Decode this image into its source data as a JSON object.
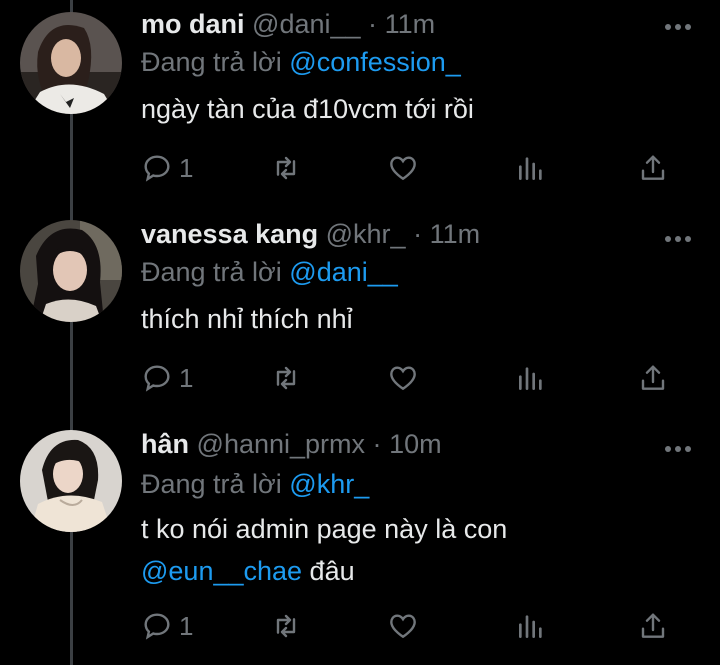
{
  "tweets": [
    {
      "name": "mo dani",
      "handle": "@dani__",
      "time": "11m",
      "reply_prefix": "Đang trả lời",
      "reply_to": "@confession_",
      "text": "ngày tàn của đ10vcm tới rồi",
      "mention_in_text": "",
      "text_after": "",
      "reply_count": "1"
    },
    {
      "name": "vanessa kang",
      "handle": "@khr_",
      "time": "11m",
      "reply_prefix": "Đang trả lời",
      "reply_to": "@dani__",
      "text": "thích nhỉ thích nhỉ",
      "mention_in_text": "",
      "text_after": "",
      "reply_count": "1"
    },
    {
      "name": "hân",
      "handle": "@hanni_prmx",
      "time": "10m",
      "reply_prefix": "Đang trả lời",
      "reply_to": "@khr_",
      "text": "t ko nói admin page này là con",
      "mention_in_text": "@eun__chae",
      "text_after": " đâu",
      "reply_count": "1"
    }
  ],
  "separator": "·",
  "icons": {
    "reply": "reply-icon",
    "retweet": "retweet-icon",
    "like": "heart-icon",
    "views": "analytics-icon",
    "share": "share-icon",
    "more": "more-icon"
  },
  "colors": {
    "background": "#000000",
    "text": "#e7e9ea",
    "muted": "#71767b",
    "accent": "#1d9bf0"
  }
}
